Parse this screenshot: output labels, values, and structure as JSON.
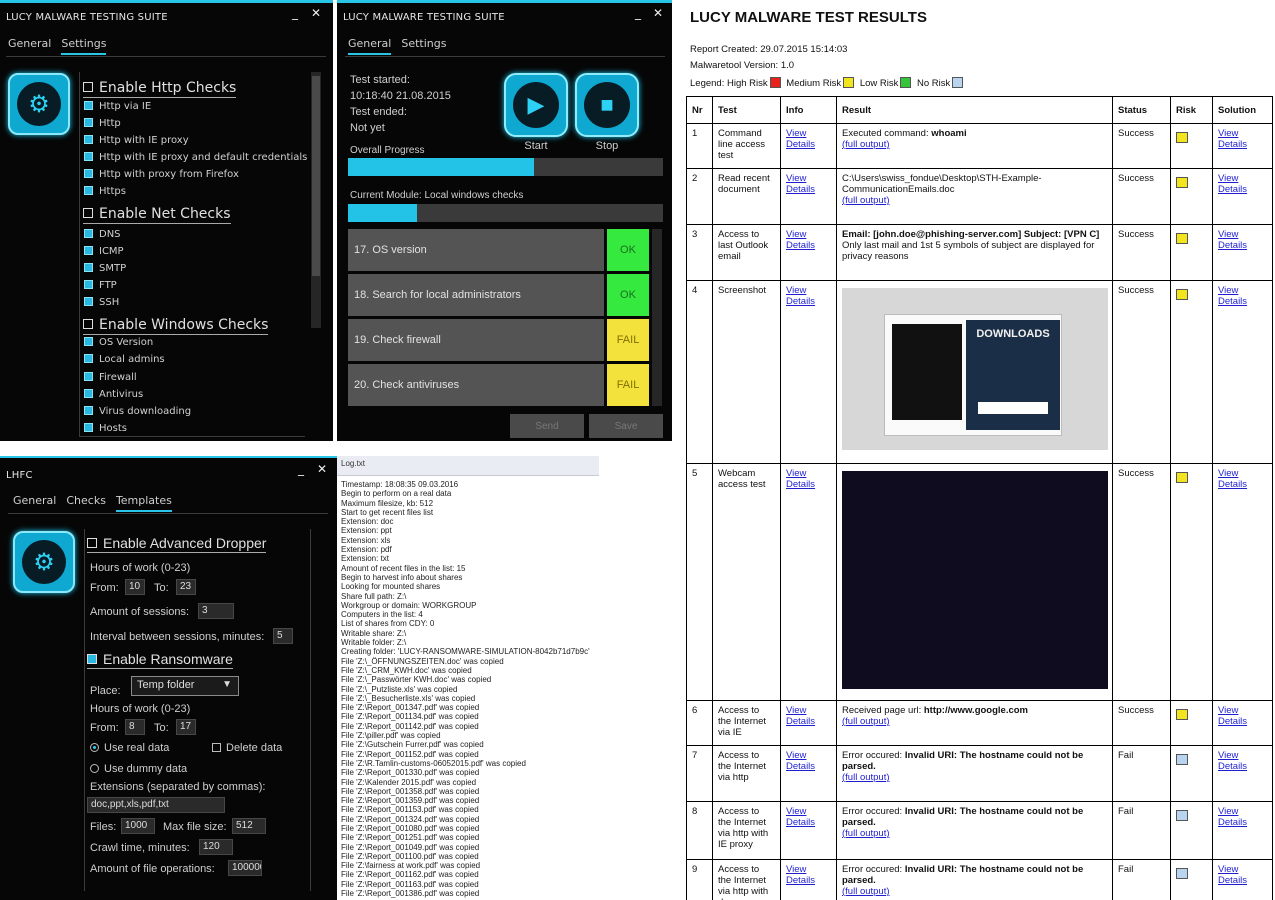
{
  "settings_window": {
    "title": "LUCY MALWARE TESTING SUITE",
    "minimize": "_",
    "close": "✕",
    "tabs": [
      "General",
      "Settings"
    ],
    "sections": [
      {
        "label": "Enable Http Checks",
        "options": [
          "Http via IE",
          "Http",
          "Http with IE proxy",
          "Http with IE proxy and default credentials",
          "Http with proxy from Firefox",
          "Https"
        ]
      },
      {
        "label": "Enable Net Checks",
        "options": [
          "DNS",
          "ICMP",
          "SMTP",
          "FTP",
          "SSH"
        ]
      },
      {
        "label": "Enable Windows Checks",
        "options": [
          "OS Version",
          "Local admins",
          "Firewall",
          "Antivirus",
          "Virus downloading",
          "Hosts"
        ]
      }
    ],
    "gear_icon": "gear-icon",
    "accent_color": "#29c5e6"
  },
  "general_window": {
    "title": "LUCY MALWARE TESTING SUITE",
    "minimize": "_",
    "close": "✕",
    "tabs": [
      "General",
      "Settings"
    ],
    "test_started_label": "Test started:",
    "test_started_value": "10:18:40 21.08.2015",
    "test_ended_label": "Test ended:",
    "test_ended_value": "Not yet",
    "start_label": "Start",
    "stop_label": "Stop",
    "overall_progress_label": "Overall Progress",
    "overall_progress": 0.59,
    "current_module_label": "Current Module: Local windows checks",
    "module_progress": 0.22,
    "modules": [
      {
        "label": "17. OS version",
        "status": "OK"
      },
      {
        "label": "18. Search for local administrators",
        "status": "OK"
      },
      {
        "label": "19. Check firewall",
        "status": "FAIL"
      },
      {
        "label": "20. Check antiviruses",
        "status": "FAIL"
      }
    ],
    "send_label": "Send",
    "save_label": "Save"
  },
  "lhfc_window": {
    "title": "LHFC",
    "minimize": "_",
    "close": "✕",
    "tabs": [
      "General",
      "Checks",
      "Templates"
    ],
    "dropper": {
      "label": "Enable Advanced Dropper",
      "hours_label": "Hours of work (0-23)",
      "from_label": "From:",
      "from_value": "10",
      "to_label": "To:",
      "to_value": "23",
      "sessions_label": "Amount of sessions:",
      "sessions_value": "3",
      "interval_label": "Interval between sessions, minutes:",
      "interval_value": "5"
    },
    "ransomware": {
      "label": "Enable Ransomware",
      "place_label": "Place:",
      "place_value": "Temp folder",
      "hours_label": "Hours of work (0-23)",
      "from_label": "From:",
      "from_value": "8",
      "to_label": "To:",
      "to_value": "17",
      "use_real_data": "Use real data",
      "delete_data": "Delete data",
      "use_dummy_data": "Use dummy data",
      "extensions_label": "Extensions (separated by commas):",
      "extensions_value": "doc,ppt,xls,pdf,txt",
      "files_label": "Files:",
      "files_value": "1000",
      "max_size_label": "Max file size:",
      "max_size_value": "512",
      "crawl_label": "Crawl time, minutes:",
      "crawl_value": "120",
      "fileops_label": "Amount of file operations:",
      "fileops_value": "100000"
    }
  },
  "log": {
    "title": "Log.txt",
    "lines": [
      "Timestamp: 18:08:35 09.03.2016",
      "Begin to perform on a real data",
      "Maximum filesize, kb: 512",
      "Start to get recent files list",
      "Extension: doc",
      "Extension: ppt",
      "Extension: xls",
      "Extension: pdf",
      "Extension: txt",
      "Amount of recent files in the list: 15",
      "Begin to harvest info about shares",
      "Looking for mounted shares",
      "Share full path: Z:\\",
      "Workgroup or domain: WORKGROUP",
      "Computers in the list: 4",
      "List of shares from CDY: 0",
      "Writable share: Z:\\",
      "Writable folder: Z:\\",
      "Creating folder: 'LUCY-RANSOMWARE-SIMULATION-8042b71d7b9c'",
      "File 'Z:\\_ÖFFNUNGSZEITEN.doc' was copied",
      "File 'Z:\\_CRM_KWH.doc' was copied",
      "File 'Z:\\_Passwörter KWH.doc' was copied",
      "File 'Z:\\_Putzliste.xls' was copied",
      "File 'Z:\\_Besucherliste.xls' was copied",
      "File 'Z:\\Report_001347.pdf' was copied",
      "File 'Z:\\Report_001134.pdf' was copied",
      "File 'Z:\\Report_001142.pdf' was copied",
      "File 'Z:\\piller.pdf' was copied",
      "File 'Z:\\Gutschein Furrer.pdf' was copied",
      "File 'Z:\\Report_001152.pdf' was copied",
      "File 'Z:\\R.Tamlin-customs-06052015.pdf' was copied",
      "File 'Z:\\Report_001330.pdf' was copied",
      "File 'Z:\\Kalender 2015.pdf' was copied",
      "File 'Z:\\Report_001358.pdf' was copied",
      "File 'Z:\\Report_001359.pdf' was copied",
      "File 'Z:\\Report_001153.pdf' was copied",
      "File 'Z:\\Report_001324.pdf' was copied",
      "File 'Z:\\Report_001080.pdf' was copied",
      "File 'Z:\\Report_001251.pdf' was copied",
      "File 'Z:\\Report_001049.pdf' was copied",
      "File 'Z:\\Report_001100.pdf' was copied",
      "File 'Z:\\fairness at work.pdf' was copied",
      "File 'Z:\\Report_001162.pdf' was copied",
      "File 'Z:\\Report_001163.pdf' was copied",
      "File 'Z:\\Report_001386.pdf' was copied"
    ]
  },
  "report": {
    "title": "LUCY MALWARE TEST RESULTS",
    "created": "Report Created: 29.07.2015 15:14:03",
    "version": "Malwaretool Version: 1.0",
    "legend_label": "Legend:",
    "legend": [
      {
        "label": "High Risk",
        "color": "#e8231c"
      },
      {
        "label": "Medium Risk",
        "color": "#f2e51e"
      },
      {
        "label": "Low Risk",
        "color": "#35c43a"
      },
      {
        "label": "No Risk",
        "color": "#b9d4ee"
      }
    ],
    "headers": [
      "Nr",
      "Test",
      "Info",
      "Result",
      "Status",
      "Risk",
      "Solution"
    ],
    "view_details": "View Details",
    "full_output": "(full output)",
    "rows": [
      {
        "nr": "1",
        "test": "Command line access test",
        "result_a": "Executed command: ",
        "result_b": "whoami",
        "status": "Success",
        "risk_color": "#f2e51e"
      },
      {
        "nr": "2",
        "test": "Read recent document",
        "result_a": "C:\\Users\\swiss_fondue\\Desktop\\STH-Example-CommunicationEmails.doc",
        "result_b": "",
        "status": "Success",
        "risk_color": "#f2e51e"
      },
      {
        "nr": "3",
        "test": "Access to last Outlook email",
        "result_a": "Email: [john.doe@phishing-server.com] Subject: [VPN C]",
        "result_b": "Only last mail and 1st 5 symbols of subject are displayed for privacy reasons",
        "status": "Success",
        "risk_color": "#f2e51e"
      },
      {
        "nr": "4",
        "test": "Screenshot",
        "result_a": "DOWNLOADS",
        "result_b": "",
        "status": "Success",
        "risk_color": "#f2e51e"
      },
      {
        "nr": "5",
        "test": "Webcam access test",
        "result_a": "",
        "result_b": "",
        "status": "Success",
        "risk_color": "#f2e51e"
      },
      {
        "nr": "6",
        "test": "Access to the Internet via IE",
        "result_a": "Received page url: ",
        "result_b": "http://www.google.com",
        "status": "Success",
        "risk_color": "#f2e51e"
      },
      {
        "nr": "7",
        "test": "Access to the Internet via http",
        "result_a": "Error occured: ",
        "result_b": "Invalid URI: The hostname could not be parsed.",
        "status": "Fail",
        "risk_color": "#b9d4ee"
      },
      {
        "nr": "8",
        "test": "Access to the Internet via http with IE proxy",
        "result_a": "Error occured: ",
        "result_b": "Invalid URI: The hostname could not be parsed.",
        "status": "Fail",
        "risk_color": "#b9d4ee"
      },
      {
        "nr": "9",
        "test": "Access to the Internet via http with d",
        "result_a": "Error occured: ",
        "result_b": "Invalid URI: The hostname could not be parsed.",
        "status": "Fail",
        "risk_color": "#b9d4ee"
      }
    ]
  }
}
